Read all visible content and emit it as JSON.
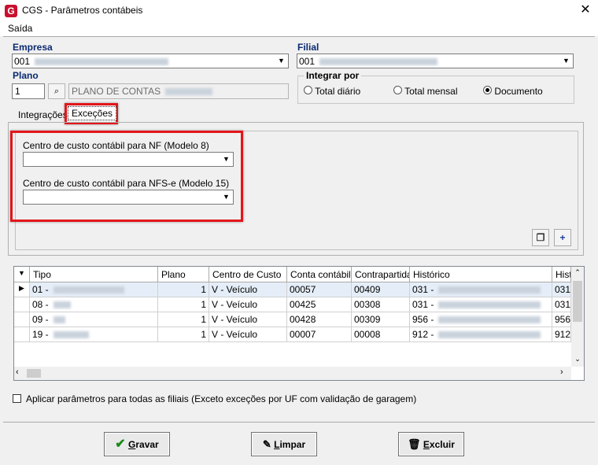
{
  "window": {
    "title": "CGS - Parâmetros contábeis",
    "close_glyph": "✕",
    "app_icon_letter": "G"
  },
  "menu": {
    "items": [
      "Saída"
    ]
  },
  "empresa": {
    "label": "Empresa",
    "value": "001"
  },
  "filial": {
    "label": "Filial",
    "value": "001"
  },
  "plano": {
    "label": "Plano",
    "code": "1",
    "name": "PLANO DE CONTAS"
  },
  "integrar": {
    "label": "Integrar por",
    "options": [
      "Total diário",
      "Total mensal",
      "Documento"
    ],
    "selected": "Documento"
  },
  "tabs": {
    "items": [
      "Integrações",
      "Exceções"
    ],
    "active": "Exceções"
  },
  "excecoes": {
    "nf_label": "Centro de custo contábil para NF (Modelo 8)",
    "nf_value": "",
    "nfse_label": "Centro de custo contábil para NFS-e (Modelo 15)",
    "nfse_value": ""
  },
  "grid": {
    "columns": [
      "Tipo",
      "Plano",
      "Centro de Custo",
      "Conta contábil",
      "Contrapartida",
      "Histórico",
      "Hist"
    ],
    "rows": [
      {
        "tipo": "01 -",
        "plano": "1",
        "centro": "V - Veículo",
        "conta": "00057",
        "contra": "00409",
        "hist": "031 -",
        "hist2": "031"
      },
      {
        "tipo": "08 -",
        "plano": "1",
        "centro": "V - Veículo",
        "conta": "00425",
        "contra": "00308",
        "hist": "031 -",
        "hist2": "031"
      },
      {
        "tipo": "09 -",
        "plano": "1",
        "centro": "V - Veículo",
        "conta": "00428",
        "contra": "00309",
        "hist": "956 -",
        "hist2": "956"
      },
      {
        "tipo": "19 -",
        "plano": "1",
        "centro": "V - Veículo",
        "conta": "00007",
        "contra": "00008",
        "hist": "912 -",
        "hist2": "912"
      }
    ],
    "selected_row": 0
  },
  "checkbox": {
    "label": "Aplicar parâmetros para todas as filiais (Exceto exceções por UF com validação de garagem)",
    "checked": false
  },
  "buttons": {
    "gravar": {
      "pre": "",
      "hot": "G",
      "post": "ravar"
    },
    "limpar": {
      "pre": "",
      "hot": "L",
      "post": "impar"
    },
    "excluir": {
      "pre": "",
      "hot": "E",
      "post": "xcluir"
    }
  },
  "colors": {
    "accent_red": "#e3161a",
    "label_blue": "#0b2a6f",
    "selection": "#e5eef8"
  }
}
